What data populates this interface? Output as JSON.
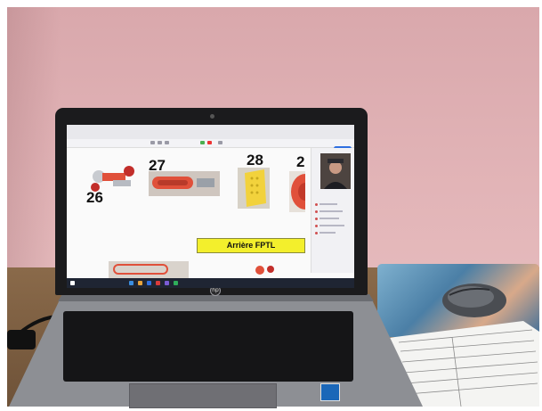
{
  "screen": {
    "slide_numbers": [
      "26",
      "27",
      "28",
      "2"
    ],
    "label": "Arrière FPTL"
  },
  "colors": {
    "wall": "#e2b4b7",
    "desk": "#7a5c40",
    "label_background": "#f3ef2c",
    "taskbar": "#1f2533",
    "accent_red": "#e0503a"
  },
  "objects": {
    "laptop_brand_icon": "hp-logo-icon",
    "mouse_icon": "wireless-mouse-icon",
    "sticker_icon": "intel-sticker-icon"
  }
}
